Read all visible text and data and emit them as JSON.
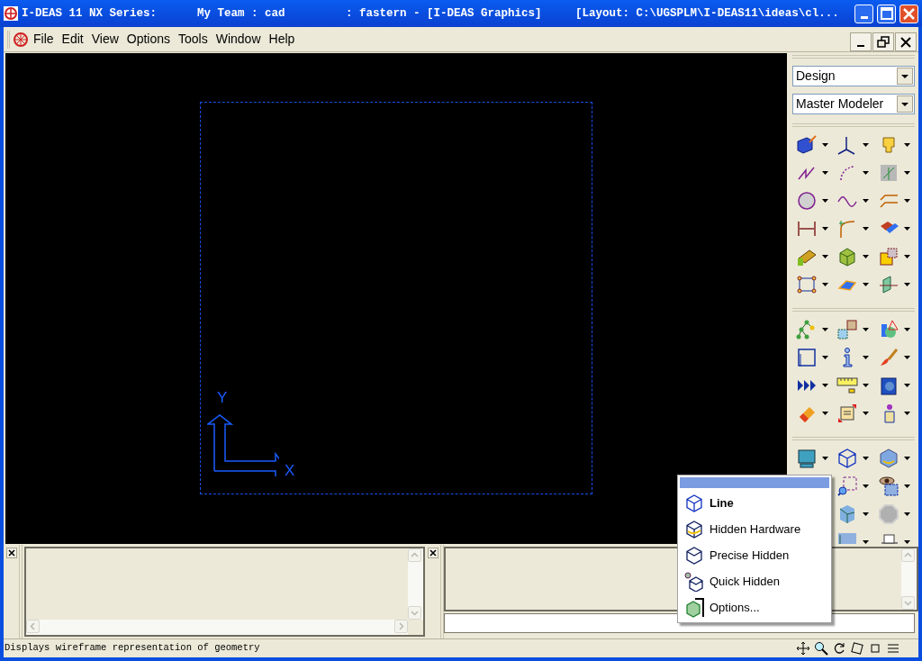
{
  "window": {
    "title": "I-DEAS 11 NX Series:      My Team : cad         : fastern - [I-DEAS Graphics]     [Layout: C:\\UGSPLM\\I-DEAS11\\ideas\\cl..."
  },
  "menu_bar": [
    "File",
    "Edit",
    "View",
    "Options",
    "Tools",
    "Window",
    "Help"
  ],
  "graphics": {
    "triad_labels": [
      "Y",
      "X"
    ]
  },
  "side_panel": {
    "dropdowns": [
      {
        "value": "Design"
      },
      {
        "value": "Master Modeler"
      }
    ]
  },
  "popup_menu": {
    "items": [
      {
        "label": "Line",
        "selected": true
      },
      {
        "label": "Hidden Hardware",
        "selected": false
      },
      {
        "label": "Precise Hidden",
        "selected": false
      },
      {
        "label": "Quick Hidden",
        "selected": false
      },
      {
        "label": "Options...",
        "selected": false
      }
    ]
  },
  "status_bar": {
    "text": "Displays wireframe representation of geometry"
  }
}
